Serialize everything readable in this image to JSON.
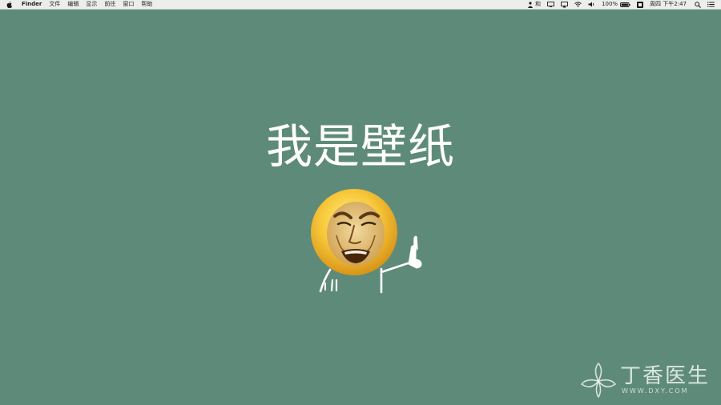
{
  "menubar": {
    "app_name": "Finder",
    "items": [
      "文件",
      "编辑",
      "显示",
      "前往",
      "窗口",
      "帮助"
    ],
    "status": {
      "input_method": "和",
      "battery": "100%",
      "clock": "周四 下午2:47"
    }
  },
  "wallpaper": {
    "text": "我是壁纸",
    "background": "#5e8b79"
  },
  "watermark": {
    "name": "丁香医生",
    "url": "WWW.DXY.COM"
  }
}
